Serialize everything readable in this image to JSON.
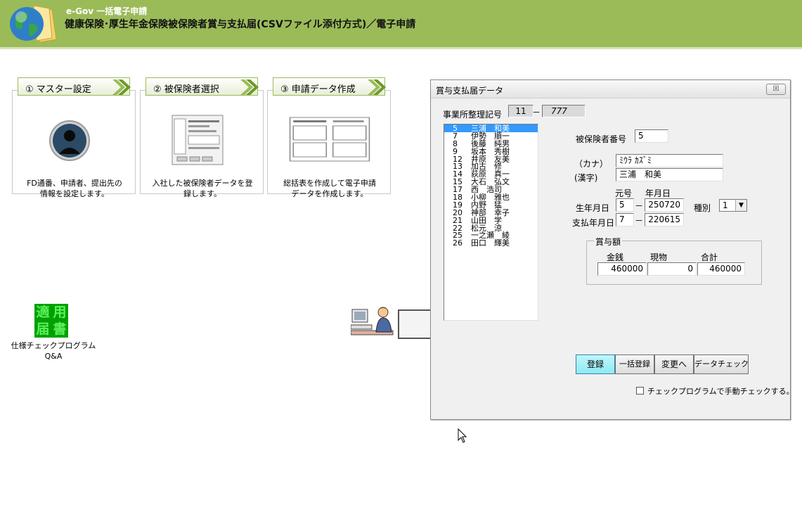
{
  "header": {
    "app_name": "e-Gov 一括電子申請",
    "title": "健康保険･厚生年金保険被保険者賞与支払届(CSVファイル添付方式)／電子申請",
    "bg_color": "#9bbb59"
  },
  "steps": [
    {
      "label": "①  マスター設定",
      "desc_line1": "FD通番、申請者、提出先の",
      "desc_line2": "情報を設定します。"
    },
    {
      "label": "②  被保険者選択",
      "desc_line1": "入社した被保険者データを登",
      "desc_line2": "録します。"
    },
    {
      "label": "③  申請データ作成",
      "desc_line1": "総括表を作成して電子申請",
      "desc_line2": "データを作成します。"
    }
  ],
  "check_program": {
    "icon_chars": [
      "適",
      "用",
      "届",
      "書"
    ],
    "caption_line1": "仕様チェックプログラム",
    "caption_line2": "Q&A"
  },
  "dialog": {
    "title": "賞与支払届データ",
    "close_symbol": "☒",
    "office_label": "事業所整理記号",
    "office_code1": "11",
    "office_dash": "－",
    "office_code2": "777",
    "insured_no_label": "被保険者番号",
    "insured_no_value": "5",
    "kana_label": "（カナ）",
    "kana_value": "ﾐｳﾗ ｶｽﾞﾐ",
    "kanji_label": "(漢字)",
    "kanji_value": "三浦　和美",
    "era_header": "元号",
    "ymd_header": "年月日",
    "birth_label": "生年月日",
    "birth_era": "5",
    "birth_date": "250720",
    "dash": "－",
    "kind_label": "種別",
    "kind_value": "1",
    "paid_label": "支払年月日",
    "paid_era": "7",
    "paid_date": "220615",
    "bonus_group_title": "賞与額",
    "cash_label": "金銭",
    "goods_label": "現物",
    "total_label": "合計",
    "cash_value": "460000",
    "goods_value": "0",
    "total_value": "460000",
    "buttons": {
      "register": "登録",
      "bulk_register": "一括登録",
      "change": "変更へ",
      "data_check": "データチェック"
    },
    "manual_check_label": "チェックプログラムで手動チェックする。",
    "list": [
      {
        "no": "5",
        "name": "三浦　和美"
      },
      {
        "no": "7",
        "name": "伊勢　順一"
      },
      {
        "no": "8",
        "name": "後藤　純男"
      },
      {
        "no": "9",
        "name": "坂本　秀樹"
      },
      {
        "no": "12",
        "name": "井原　友美"
      },
      {
        "no": "13",
        "name": "加古　修"
      },
      {
        "no": "14",
        "name": "荻原　真一"
      },
      {
        "no": "15",
        "name": "大石　弘文"
      },
      {
        "no": "17",
        "name": "西　浩司"
      },
      {
        "no": "18",
        "name": "小柳　雅也"
      },
      {
        "no": "19",
        "name": "内野　猛"
      },
      {
        "no": "20",
        "name": "神部　幸子"
      },
      {
        "no": "21",
        "name": "山田　学"
      },
      {
        "no": "22",
        "name": "松元　涼"
      },
      {
        "no": "25",
        "name": "一之瀬　綾"
      },
      {
        "no": "26",
        "name": "田口　輝美"
      }
    ]
  }
}
